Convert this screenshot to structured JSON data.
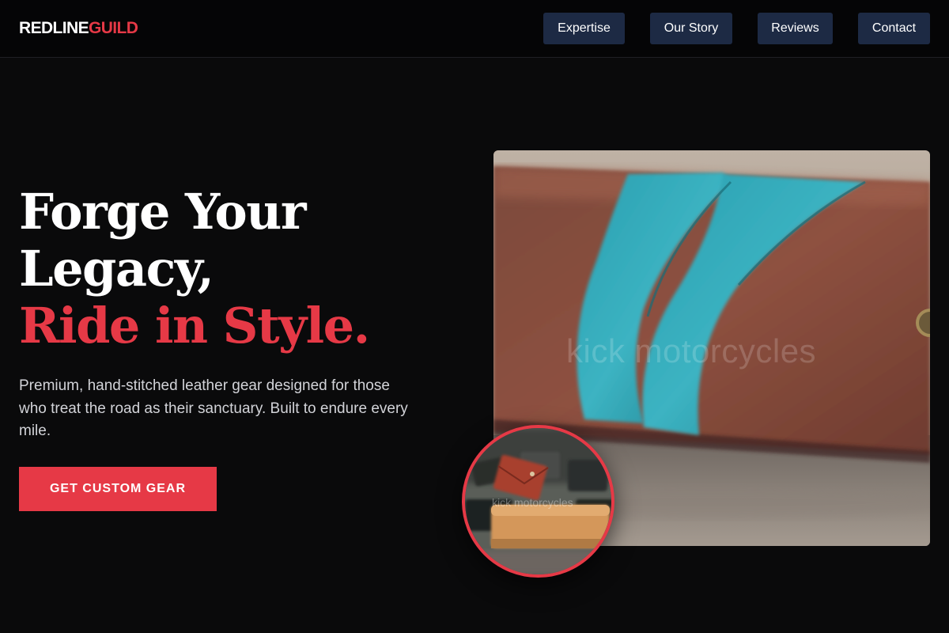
{
  "brand": {
    "name_white": "REDLINE",
    "name_red": "GUILD"
  },
  "nav": {
    "items": [
      {
        "label": "Expertise"
      },
      {
        "label": "Our Story"
      },
      {
        "label": "Reviews"
      },
      {
        "label": "Contact"
      }
    ]
  },
  "hero": {
    "headline_line1": "Forge Your",
    "headline_line2": "Legacy,",
    "headline_line3": "Ride in Style.",
    "description": "Premium, hand-stitched leather gear designed for those who treat the road as their sanctuary. Built to endure every mile.",
    "cta_label": "GET CUSTOM GEAR"
  },
  "images": {
    "main_watermark": "kick motorcycles",
    "inset_watermark": "kick motorcycles"
  },
  "colors": {
    "background": "#0a0a0b",
    "accent_red": "#e63946",
    "nav_button": "#1d2a44",
    "body_text": "#d2d3d8"
  }
}
